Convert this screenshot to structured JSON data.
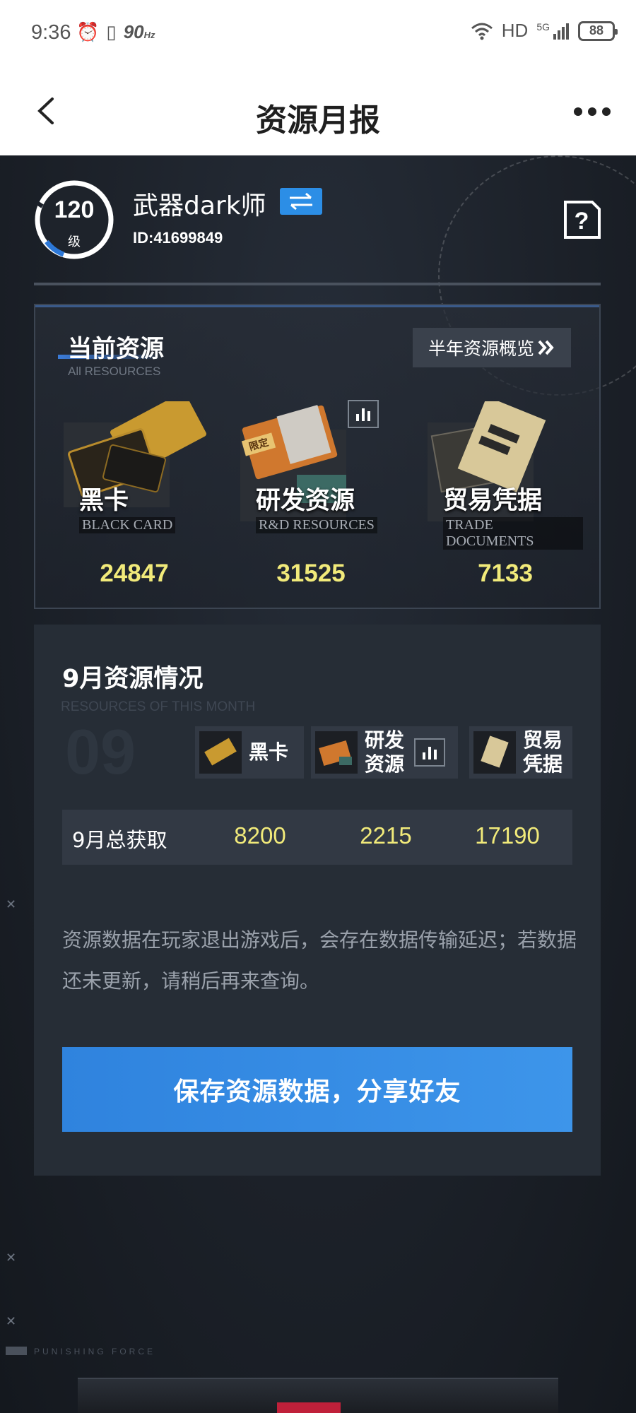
{
  "status_bar": {
    "time": "9:36",
    "refresh_rate": "90",
    "refresh_unit": "Hz",
    "network": "HD",
    "signal": "5G",
    "battery": "88"
  },
  "header": {
    "title": "资源月报"
  },
  "profile": {
    "level": "120",
    "level_label": "级",
    "username": "武器dark师",
    "user_id": "ID:41699849"
  },
  "current_resources": {
    "title": "当前资源",
    "subtitle": "All RESOURCES",
    "overview_button": "半年资源概览",
    "items": [
      {
        "name": "黑卡",
        "name_en": "BLACK CARD",
        "value": "24847"
      },
      {
        "name": "研发资源",
        "name_en": "R&D RESOURCES",
        "badge": "限定",
        "value": "31525"
      },
      {
        "name": "贸易凭据",
        "name_en": "TRADE DOCUMENTS",
        "value": "7133"
      }
    ]
  },
  "month": {
    "title": "9月资源情况",
    "subtitle": "RESOURCES OF THIS MONTH",
    "big_number": "09",
    "columns": [
      "黑卡",
      "研发资源",
      "贸易凭据"
    ],
    "column_lines": [
      [
        "黑卡"
      ],
      [
        "研发",
        "资源"
      ],
      [
        "贸易",
        "凭据"
      ]
    ],
    "total_label": "9月总获取",
    "totals": [
      "8200",
      "2215",
      "17190"
    ],
    "notice": "资源数据在玩家退出游戏后，会存在数据传输延迟；若数据还未更新，请稍后再来查询。",
    "save_button": "保存资源数据，分享好友"
  },
  "footer": {
    "brand": "PUNISHING FORCE"
  },
  "colors": {
    "accent_blue": "#2f83de",
    "value_yellow": "#f1ea7a",
    "panel_bg": "#262d36"
  },
  "icons": [
    "back-arrow-icon",
    "more-dots-icon",
    "switch-account-icon",
    "help-icon",
    "stats-chart-icon",
    "wifi-icon",
    "alarm-icon",
    "vibrate-icon"
  ]
}
